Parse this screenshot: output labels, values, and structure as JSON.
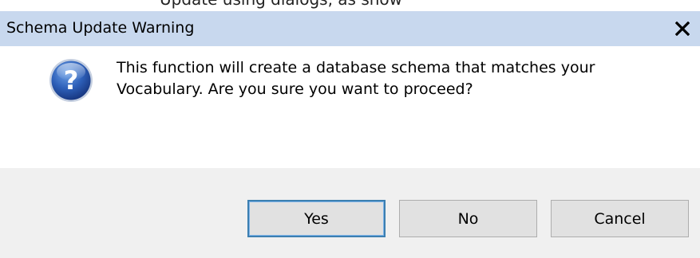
{
  "background_text": "Update using dialogs, as show",
  "dialog": {
    "title": "Schema Update Warning",
    "message_line1": "This function will create a database schema that matches your",
    "message_line2": "Vocabulary.  Are you sure you want to proceed?",
    "icon": "question-icon",
    "buttons": {
      "yes": "Yes",
      "no": "No",
      "cancel": "Cancel"
    },
    "default_button": "yes"
  },
  "colors": {
    "titlebar": "#c8d8ee",
    "footer": "#f0f0f0",
    "button_face": "#e1e1e1",
    "default_button_border": "#3c7fb1"
  }
}
